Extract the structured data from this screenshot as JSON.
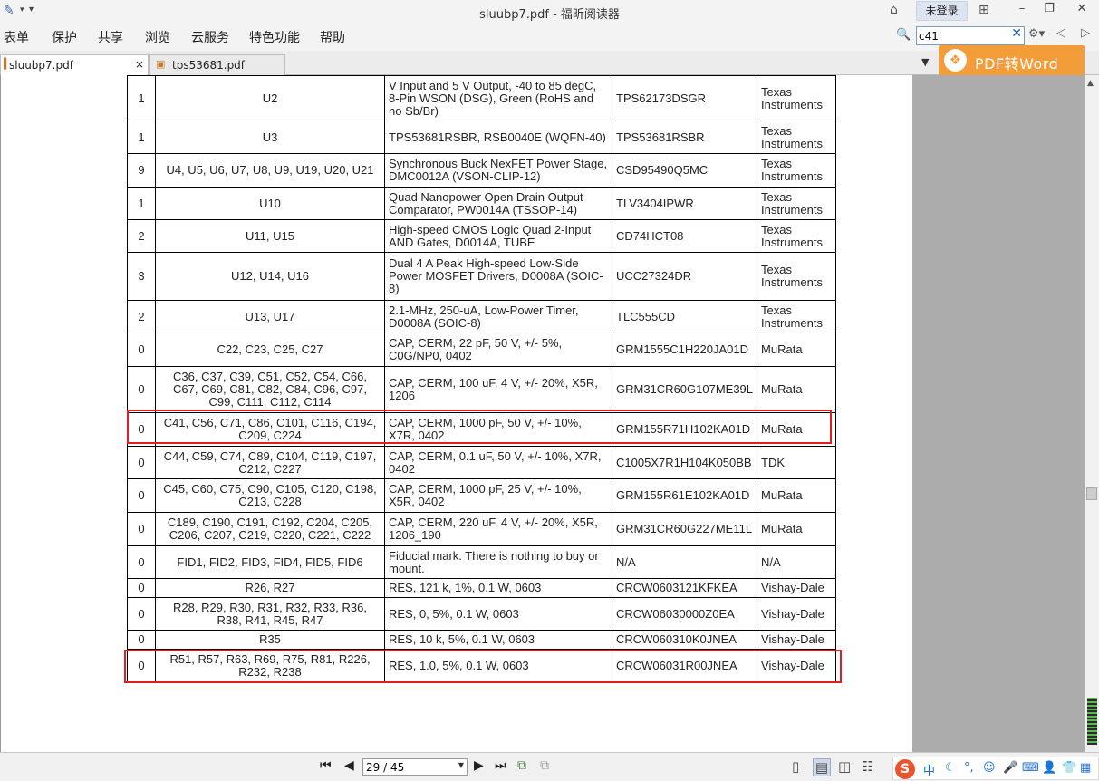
{
  "window": {
    "title": "sluubp7.pdf - 福昕阅读器",
    "login": "未登录"
  },
  "menu": [
    "表单",
    "保护",
    "共享",
    "浏览",
    "云服务",
    "特色功能",
    "帮助"
  ],
  "search": {
    "value": "c41"
  },
  "tabs": [
    {
      "label": "sluubp7.pdf",
      "close": "×",
      "active": true
    },
    {
      "label": "tps53681.pdf",
      "active": false
    }
  ],
  "promo": {
    "label": "PDF转Word"
  },
  "bom_rows": [
    {
      "qty": "1",
      "designator": "U2",
      "description": "V Input and 5 V Output, -40 to 85 degC, 8-Pin WSON (DSG), Green (RoHS and no Sb/Br)",
      "part_number": "TPS62173DSGR",
      "manufacturer": "Texas Instruments"
    },
    {
      "qty": "1",
      "designator": "U3",
      "description": "TPS53681RSBR, RSB0040E (WQFN-40)",
      "part_number": "TPS53681RSBR",
      "manufacturer": "Texas Instruments"
    },
    {
      "qty": "9",
      "designator": "U4, U5, U6, U7, U8, U9, U19, U20, U21",
      "description": "Synchronous Buck NexFET Power Stage, DMC0012A (VSON-CLIP-12)",
      "part_number": "CSD95490Q5MC",
      "manufacturer": "Texas Instruments"
    },
    {
      "qty": "1",
      "designator": "U10",
      "description": "Quad Nanopower Open Drain Output Comparator, PW0014A (TSSOP-14)",
      "part_number": "TLV3404IPWR",
      "manufacturer": "Texas Instruments"
    },
    {
      "qty": "2",
      "designator": "U11, U15",
      "description": "High-speed CMOS Logic Quad 2-Input AND Gates, D0014A, TUBE",
      "part_number": "CD74HCT08",
      "manufacturer": "Texas Instruments"
    },
    {
      "qty": "3",
      "designator": "U12, U14, U16",
      "description": "Dual 4 A Peak High-speed Low-Side Power MOSFET Drivers, D0008A (SOIC-8)",
      "part_number": "UCC27324DR",
      "manufacturer": "Texas Instruments"
    },
    {
      "qty": "2",
      "designator": "U13, U17",
      "description": "2.1-MHz, 250-uA, Low-Power Timer, D0008A (SOIC-8)",
      "part_number": "TLC555CD",
      "manufacturer": "Texas Instruments"
    },
    {
      "qty": "0",
      "designator": "C22, C23, C25, C27",
      "description": "CAP, CERM, 22 pF, 50 V, +/- 5%, C0G/NP0, 0402",
      "part_number": "GRM1555C1H220JA01D",
      "manufacturer": "MuRata"
    },
    {
      "qty": "0",
      "designator": "C36, C37, C39, C51, C52, C54, C66, C67, C69, C81, C82, C84, C96, C97, C99, C111, C112, C114",
      "description": "CAP, CERM, 100 uF, 4 V, +/- 20%, X5R, 1206",
      "part_number": "GRM31CR60G107ME39L",
      "manufacturer": "MuRata"
    },
    {
      "qty": "0",
      "designator": "C41, C56, C71, C86, C101, C116, C194, C209, C224",
      "description": "CAP, CERM, 1000 pF, 50 V, +/- 10%, X7R, 0402",
      "part_number": "GRM155R71H102KA01D",
      "manufacturer": "MuRata"
    },
    {
      "qty": "0",
      "designator": "C44, C59, C74, C89, C104, C119, C197, C212, C227",
      "description": "CAP, CERM, 0.1 uF, 50 V, +/- 10%, X7R, 0402",
      "part_number": "C1005X7R1H104K050BB",
      "manufacturer": "TDK"
    },
    {
      "qty": "0",
      "designator": "C45, C60, C75, C90, C105, C120, C198, C213, C228",
      "description": "CAP, CERM, 1000 pF, 25 V, +/- 10%, X5R, 0402",
      "part_number": "GRM155R61E102KA01D",
      "manufacturer": "MuRata"
    },
    {
      "qty": "0",
      "designator": "C189, C190, C191, C192, C204, C205, C206, C207, C219, C220, C221, C222",
      "description": "CAP, CERM, 220 uF, 4 V, +/- 20%, X5R, 1206_190",
      "part_number": "GRM31CR60G227ME11L",
      "manufacturer": "MuRata"
    },
    {
      "qty": "0",
      "designator": "FID1, FID2, FID3, FID4, FID5, FID6",
      "description": "Fiducial mark. There is nothing to buy or mount.",
      "part_number": "N/A",
      "manufacturer": "N/A"
    },
    {
      "qty": "0",
      "designator": "R26, R27",
      "description": "RES, 121 k, 1%, 0.1 W, 0603",
      "part_number": "CRCW0603121KFKEA",
      "manufacturer": "Vishay-Dale"
    },
    {
      "qty": "0",
      "designator": "R28, R29, R30, R31, R32, R33, R36, R38, R41, R45, R47",
      "description": "RES, 0, 5%, 0.1 W, 0603",
      "part_number": "CRCW06030000Z0EA",
      "manufacturer": "Vishay-Dale"
    },
    {
      "qty": "0",
      "designator": "R35",
      "description": "RES, 10 k, 5%, 0.1 W, 0603",
      "part_number": "CRCW060310K0JNEA",
      "manufacturer": "Vishay-Dale"
    },
    {
      "qty": "0",
      "designator": "R51, R57, R63, R69, R75, R81, R226, R232, R238",
      "description": "RES, 1.0, 5%, 0.1 W, 0603",
      "part_number": "CRCW06031R00JNEA",
      "manufacturer": "Vishay-Dale"
    }
  ],
  "pager": {
    "value": "29 / 45"
  },
  "ime": {
    "lang": "中"
  },
  "colors": {
    "highlight": "#e02020",
    "promo": "#f39c3a",
    "accent": "#1b5fb8"
  }
}
